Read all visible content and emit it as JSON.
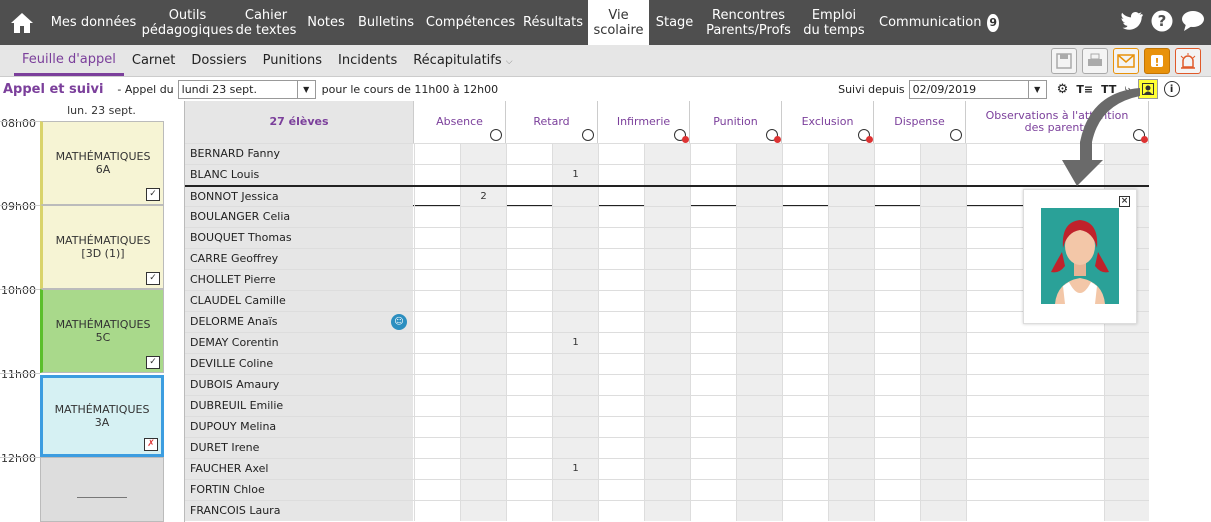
{
  "nav": {
    "items": [
      {
        "label": "Mes données"
      },
      {
        "label": "Outils\npédagogiques"
      },
      {
        "label": "Cahier\nde textes"
      },
      {
        "label": "Notes"
      },
      {
        "label": "Bulletins"
      },
      {
        "label": "Compétences"
      },
      {
        "label": "Résultats"
      },
      {
        "label": "Vie\nscolaire"
      },
      {
        "label": "Stage"
      },
      {
        "label": "Rencontres\nParents/Profs"
      },
      {
        "label": "Emploi\ndu temps"
      },
      {
        "label": "Communication"
      }
    ],
    "communication_badge": "9"
  },
  "subtabs": [
    "Feuille d'appel",
    "Carnet",
    "Dossiers",
    "Punitions",
    "Incidents",
    "Récapitulatifs"
  ],
  "toolbar": {
    "title": "Appel et suivi",
    "appel_du": "- Appel du",
    "date_value": "lundi 23 sept.",
    "cours": "pour le cours de 11h00 à 12h00",
    "suivi_label": "Suivi depuis",
    "suivi_value": "02/09/2019"
  },
  "calendar": {
    "day": "lun. 23 sept.",
    "hours": [
      "08h00",
      "09h00",
      "10h00",
      "11h00",
      "12h00"
    ],
    "courses": [
      {
        "subject": "MATHÉMATIQUES",
        "group": "6A",
        "color": "#f6f4d4",
        "accent": "#d9d36b"
      },
      {
        "subject": "MATHÉMATIQUES",
        "group": "[3D (1)]",
        "color": "#f6f4d4",
        "accent": "#d9d36b"
      },
      {
        "subject": "MATHÉMATIQUES",
        "group": "5C",
        "color": "#a9d98b",
        "accent": "#5bbf2b"
      },
      {
        "subject": "MATHÉMATIQUES",
        "group": "3A",
        "color": "#d6f1f3",
        "accent": "#3c9de0"
      }
    ]
  },
  "grid": {
    "count_label": "27 élèves",
    "columns": [
      "Absence",
      "Retard",
      "Infirmerie",
      "Punition",
      "Exclusion",
      "Dispense"
    ],
    "observations": "Observations à l'attention des parents",
    "students": [
      {
        "name": "BERNARD Fanny",
        "absence": "",
        "retard": ""
      },
      {
        "name": "BLANC Louis",
        "absence": "",
        "retard": "1"
      },
      {
        "name": "BONNOT Jessica",
        "absence": "2",
        "retard": ""
      },
      {
        "name": "BOULANGER Celia",
        "absence": "",
        "retard": ""
      },
      {
        "name": "BOUQUET Thomas",
        "absence": "",
        "retard": ""
      },
      {
        "name": "CARRE Geoffrey",
        "absence": "",
        "retard": ""
      },
      {
        "name": "CHOLLET Pierre",
        "absence": "",
        "retard": ""
      },
      {
        "name": "CLAUDEL Camille",
        "absence": "",
        "retard": ""
      },
      {
        "name": "DELORME Anaïs",
        "absence": "",
        "retard": ""
      },
      {
        "name": "DEMAY Corentin",
        "absence": "",
        "retard": "1"
      },
      {
        "name": "DEVILLE Coline",
        "absence": "",
        "retard": ""
      },
      {
        "name": "DUBOIS Amaury",
        "absence": "",
        "retard": ""
      },
      {
        "name": "DUBREUIL Emilie",
        "absence": "",
        "retard": ""
      },
      {
        "name": "DUPOUY Melina",
        "absence": "",
        "retard": ""
      },
      {
        "name": "DURET Irene",
        "absence": "",
        "retard": ""
      },
      {
        "name": "FAUCHER Axel",
        "absence": "",
        "retard": "1"
      },
      {
        "name": "FORTIN Chloe",
        "absence": "",
        "retard": ""
      },
      {
        "name": "FRANCOIS Laura",
        "absence": "",
        "retard": ""
      }
    ]
  },
  "colors": {
    "accent": "#7b3f9b",
    "topbar": "#4f4f4f",
    "highlight": "#ffff33"
  }
}
